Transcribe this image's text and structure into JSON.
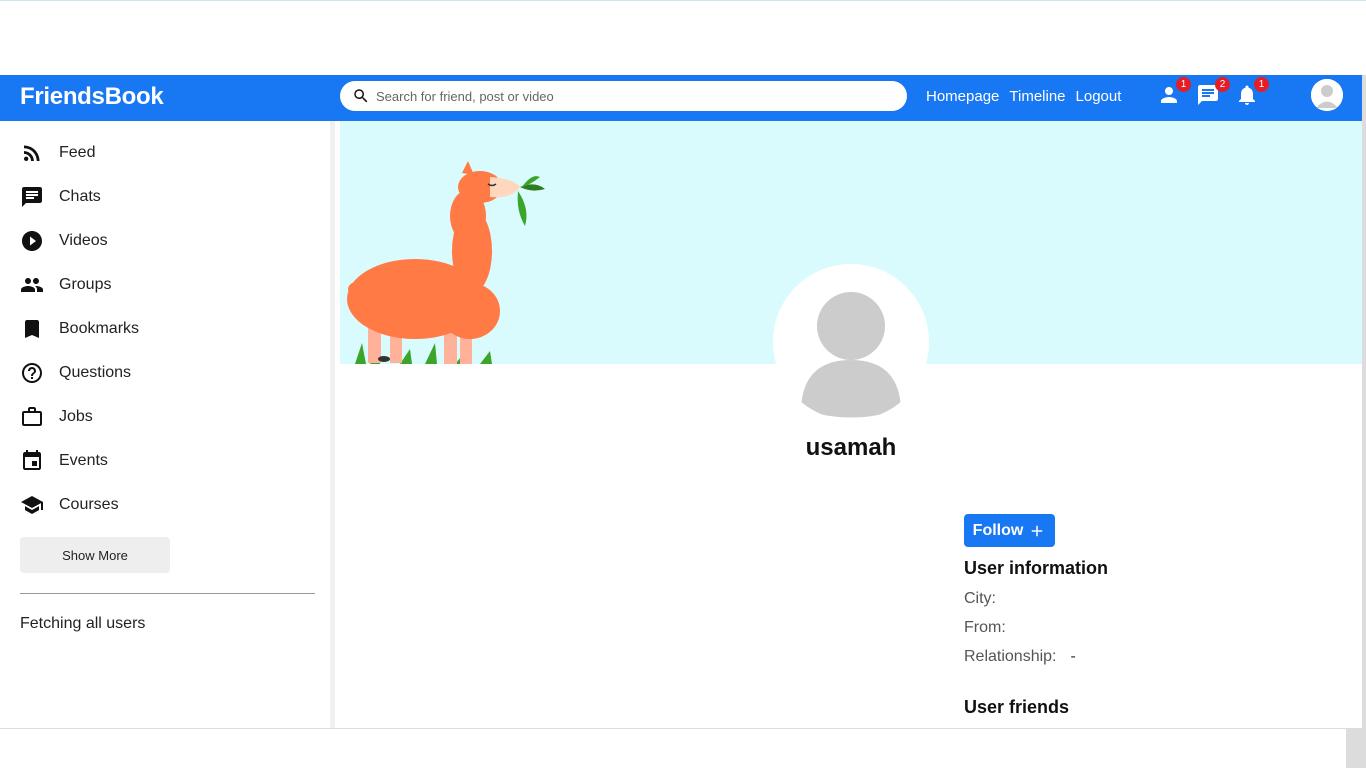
{
  "header": {
    "logo": "FriendsBook",
    "search_placeholder": "Search for friend, post or video",
    "links": [
      "Homepage",
      "Timeline",
      "Logout"
    ],
    "badges": {
      "friends": "1",
      "messages": "2",
      "notifications": "1"
    }
  },
  "sidebar": {
    "items": [
      {
        "label": "Feed",
        "icon": "rss-feed-icon"
      },
      {
        "label": "Chats",
        "icon": "chat-icon"
      },
      {
        "label": "Videos",
        "icon": "play-circle-icon"
      },
      {
        "label": "Groups",
        "icon": "group-icon"
      },
      {
        "label": "Bookmarks",
        "icon": "bookmark-icon"
      },
      {
        "label": "Questions",
        "icon": "help-icon"
      },
      {
        "label": "Jobs",
        "icon": "work-icon"
      },
      {
        "label": "Events",
        "icon": "event-icon"
      },
      {
        "label": "Courses",
        "icon": "school-icon"
      }
    ],
    "show_more": "Show More",
    "status": "Fetching all users"
  },
  "profile": {
    "username": "usamah",
    "follow_label": "Follow",
    "info_title": "User information",
    "city_label": "City:",
    "city_value": "",
    "from_label": "From:",
    "from_value": "",
    "relationship_label": "Relationship:",
    "relationship_value": "-",
    "friends_title": "User friends"
  },
  "colors": {
    "brand": "#1877f2",
    "badge": "#e41e26",
    "cover": "#dafbfd",
    "llama": "#ff7a45"
  }
}
